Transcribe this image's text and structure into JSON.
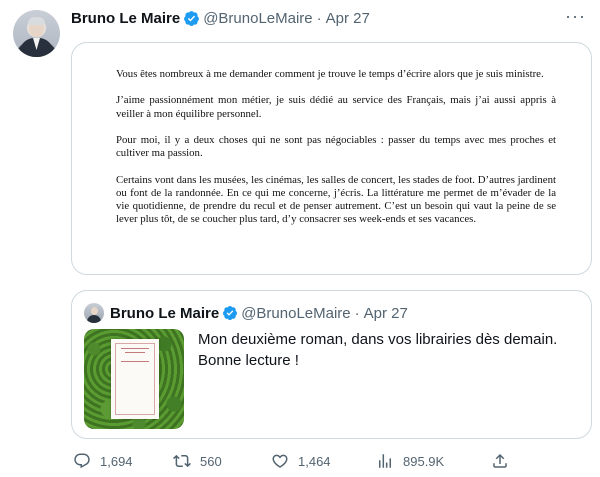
{
  "tweet": {
    "author_name": "Bruno Le Maire",
    "handle": "@BrunoLeMaire",
    "separator": "·",
    "date": "Apr 27",
    "more_label": "···",
    "document_paragraphs": [
      "Vous êtes nombreux à me demander comment je trouve le temps d’écrire alors que je suis ministre.",
      "J’aime passionnément mon métier, je suis dédié au service des Français, mais j’ai aussi appris à veiller à mon équilibre personnel.",
      "Pour moi, il y a deux choses qui ne sont pas négociables : passer du temps avec mes proches et cultiver ma passion.",
      "Certains vont dans les musées, les cinémas, les salles de concert, les stades de foot. D’autres jardinent ou font de la randonnée. En ce qui me concerne, j’écris. La littérature me permet de m’évader de la vie quotidienne, de prendre du recul et de penser autrement. C’est un besoin qui vaut la peine de se lever plus tôt, de se coucher plus tard, d’y consacrer ses week-ends et ses vacances."
    ]
  },
  "quoted": {
    "author_name": "Bruno Le Maire",
    "handle": "@BrunoLeMaire",
    "separator": "·",
    "date": "Apr 27",
    "text": "Mon deuxième roman, dans vos librairies dès demain. Bonne lecture !"
  },
  "actions": {
    "replies": "1,694",
    "retweets": "560",
    "likes": "1,464",
    "views": "895.9K"
  },
  "icons": {
    "verified": "verified-badge-icon",
    "reply": "reply-icon",
    "retweet": "retweet-icon",
    "like": "heart-icon",
    "views": "views-bar-chart-icon",
    "share": "share-icon"
  },
  "colors": {
    "text_primary": "#0f1419",
    "text_secondary": "#536471",
    "verified_blue": "#1d9bf0",
    "border": "#cfd9de"
  }
}
